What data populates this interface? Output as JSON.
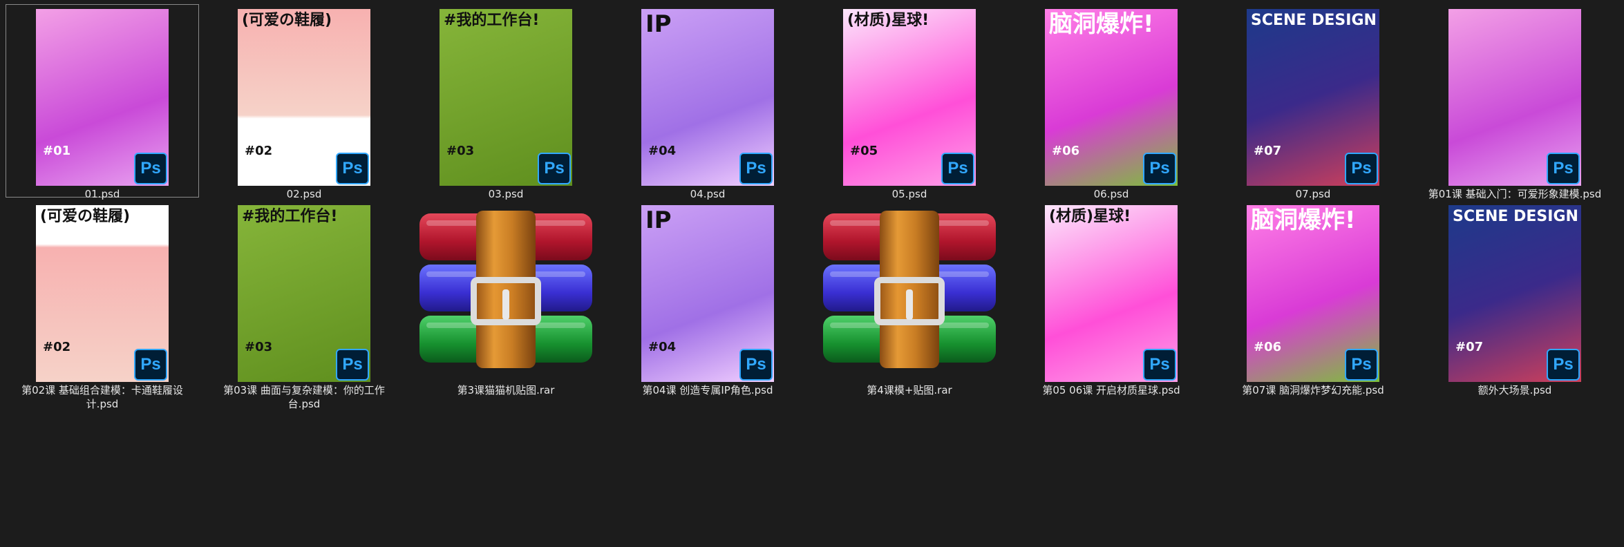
{
  "ps_badge": "Ps",
  "items": [
    {
      "label": "01.psd",
      "kind": "psd",
      "icon": "ps-file-icon",
      "selected": true,
      "poster": {
        "title": "",
        "num": "#01",
        "bg": "linear-gradient(160deg,#f3a0e6,#c94ad8 60%,#e9a3f0)"
      }
    },
    {
      "label": "02.psd",
      "kind": "psd",
      "icon": "ps-file-icon",
      "poster": {
        "title": "(可爱の鞋履)",
        "num": "#02",
        "bg": "linear-gradient(180deg,#f7b1b0,#f6d2c8 60%,#ffffff 62%)"
      }
    },
    {
      "label": "03.psd",
      "kind": "psd",
      "icon": "ps-file-icon",
      "poster": {
        "title": "#我的工作台!",
        "num": "#03",
        "bg": "linear-gradient(160deg,#86b53a,#5f8f1e)"
      }
    },
    {
      "label": "04.psd",
      "kind": "psd",
      "icon": "ps-file-icon",
      "poster": {
        "title": "IP",
        "num": "#04",
        "bg": "linear-gradient(160deg,#cba0f5,#a070e6 60%,#f2d0ff)"
      }
    },
    {
      "label": "05.psd",
      "kind": "psd",
      "icon": "ps-file-icon",
      "poster": {
        "title": "(材质)星球!",
        "num": "#05",
        "bg": "linear-gradient(160deg,#fce6fb,#ff4fd8 60%,#ff9fe8)"
      }
    },
    {
      "label": "06.psd",
      "kind": "psd",
      "icon": "ps-file-icon",
      "poster": {
        "title": "脑洞爆炸!",
        "num": "#06",
        "bg": "linear-gradient(160deg,#ff7fe6,#d93bd6 55%,#7dbf3a)"
      }
    },
    {
      "label": "07.psd",
      "kind": "psd",
      "icon": "ps-file-icon",
      "poster": {
        "title": "SCENE DESIGN",
        "num": "#07",
        "bg": "linear-gradient(160deg,#1d3a8a,#3b2a8a 50%,#d0405a)"
      }
    },
    {
      "label": "第01课 基础入门：可爱形象建模.psd",
      "kind": "psd",
      "icon": "ps-file-icon",
      "poster": {
        "title": "",
        "num": "",
        "bg": "linear-gradient(160deg,#f3a0e6,#c94ad8 60%,#e9a3f0)"
      }
    },
    {
      "label": "第02课 基础组合建模：卡通鞋履设计.psd",
      "kind": "psd",
      "icon": "ps-file-icon",
      "poster": {
        "title": "(可爱の鞋履)",
        "num": "#02",
        "bg": "linear-gradient(180deg,#ffffff 22%,#f7b1b0 24%,#f6d2c8)"
      }
    },
    {
      "label": "第03课 曲面与复杂建模：你的工作台.psd",
      "kind": "psd",
      "icon": "ps-file-icon",
      "poster": {
        "title": "#我的工作台!",
        "num": "#03",
        "bg": "linear-gradient(160deg,#86b53a,#5f8f1e)"
      }
    },
    {
      "label": "第3课猫猫机贴图.rar",
      "kind": "rar",
      "icon": "winrar-archive-icon"
    },
    {
      "label": "第04课 创造专属IP角色.psd",
      "kind": "psd",
      "icon": "ps-file-icon",
      "poster": {
        "title": "IP",
        "num": "#04",
        "bg": "linear-gradient(160deg,#cba0f5,#a070e6 60%,#f2d0ff)"
      }
    },
    {
      "label": "第4课模+贴图.rar",
      "kind": "rar",
      "icon": "winrar-archive-icon"
    },
    {
      "label": "第05 06课 开启材质星球.psd",
      "kind": "psd",
      "icon": "ps-file-icon",
      "poster": {
        "title": "(材质)星球!",
        "num": "",
        "bg": "linear-gradient(160deg,#fce6fb,#ff4fd8 60%,#ff9fe8)"
      }
    },
    {
      "label": "第07课 脑洞爆炸梦幻充能.psd",
      "kind": "psd",
      "icon": "ps-file-icon",
      "poster": {
        "title": "脑洞爆炸!",
        "num": "#06",
        "bg": "linear-gradient(160deg,#ff7fe6,#d93bd6 55%,#7dbf3a)"
      }
    },
    {
      "label": "额外大场景.psd",
      "kind": "psd",
      "icon": "ps-file-icon",
      "poster": {
        "title": "SCENE DESIGN",
        "num": "#07",
        "bg": "linear-gradient(160deg,#1d3a8a,#3b2a8a 50%,#d0405a)"
      }
    }
  ]
}
